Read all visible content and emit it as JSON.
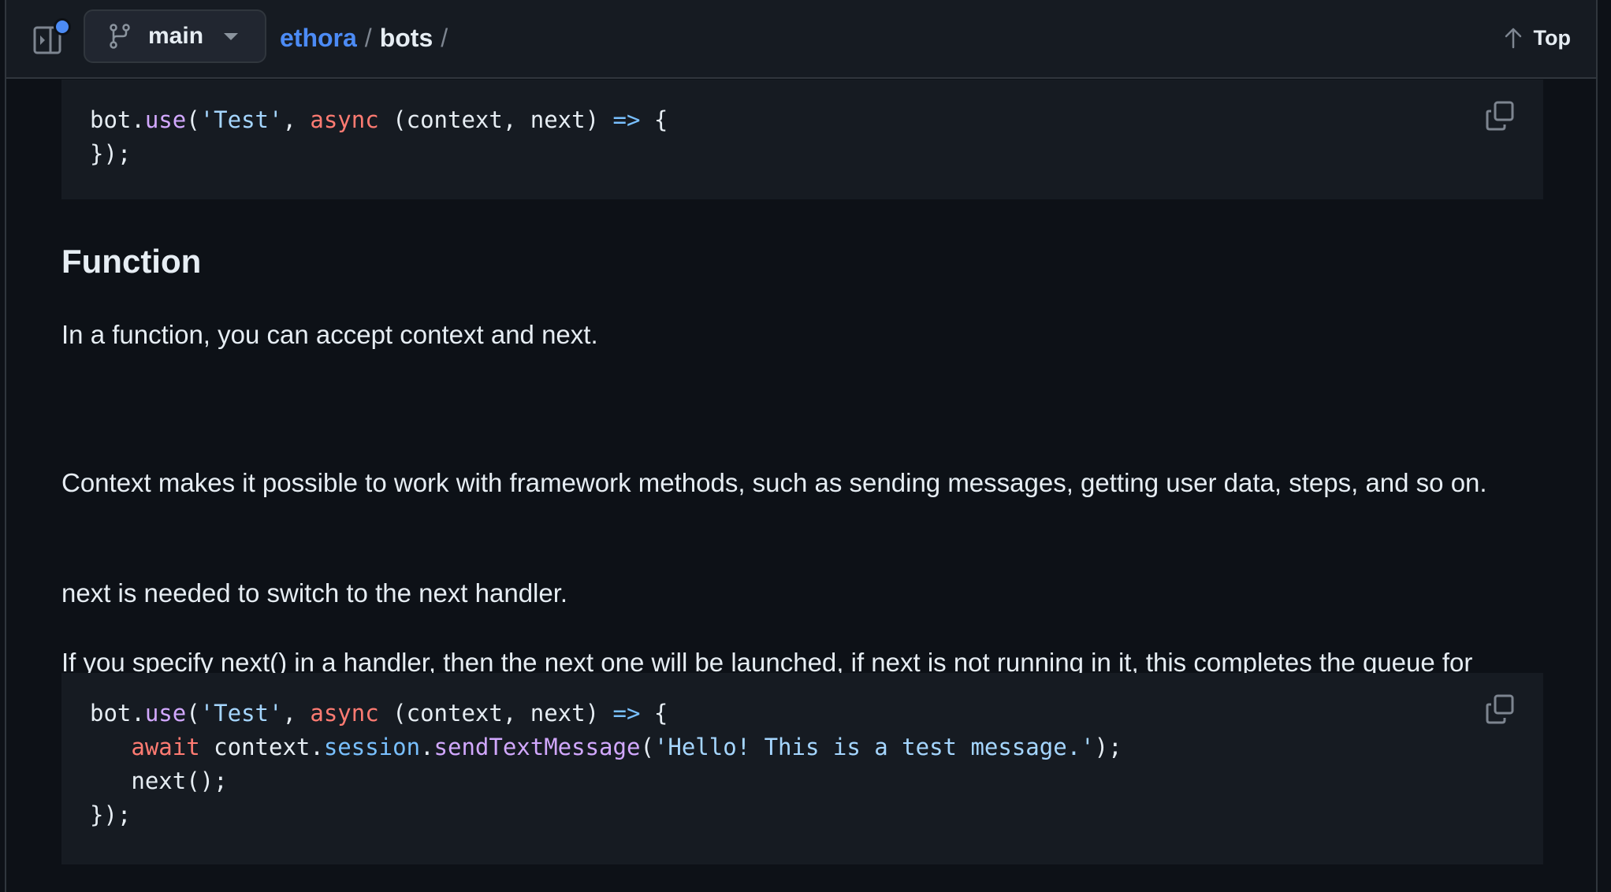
{
  "header": {
    "sidebar_toggle_icon": "sidebar-expand-icon",
    "branch": {
      "icon": "git-branch-icon",
      "name": "main",
      "dropdown_icon": "caret-down-icon"
    },
    "breadcrumb": {
      "repo": "ethora",
      "separator": "/",
      "folder": "bots",
      "trailing_separator": "/"
    },
    "top_button": {
      "icon": "arrow-up-icon",
      "label": "Top"
    }
  },
  "colors": {
    "accent": "#4c8bf5",
    "background": "#0d1117",
    "code_background": "#161b22",
    "text": "#e6edf3",
    "syntax_function": "#d2a8ff",
    "syntax_string": "#a5d6ff",
    "syntax_keyword": "#ff7b72",
    "syntax_operator": "#79c0ff"
  },
  "content": {
    "code_block_1": {
      "copy_icon": "copy-icon",
      "lines": [
        [
          {
            "t": "bot.",
            "c": ""
          },
          {
            "t": "use",
            "c": "fn"
          },
          {
            "t": "(",
            "c": ""
          },
          {
            "t": "'Test'",
            "c": "str"
          },
          {
            "t": ", ",
            "c": ""
          },
          {
            "t": "async",
            "c": "kw"
          },
          {
            "t": " (context, next) ",
            "c": ""
          },
          {
            "t": "=>",
            "c": "op"
          },
          {
            "t": " {",
            "c": ""
          }
        ],
        [
          {
            "t": "});",
            "c": ""
          }
        ]
      ]
    },
    "heading": "Function",
    "paragraphs": [
      "In a function, you can accept context and next.",
      "Context makes it possible to work with framework methods, such as sending messages, getting user data, steps, and so on.",
      "next is needed to switch to the next handler.",
      "If you specify next() in a handler, then the next one will be launched, if next is not running in it, this completes the queue for launching handlers."
    ],
    "code_block_2": {
      "copy_icon": "copy-icon",
      "lines": [
        [
          {
            "t": "bot.",
            "c": ""
          },
          {
            "t": "use",
            "c": "fn"
          },
          {
            "t": "(",
            "c": ""
          },
          {
            "t": "'Test'",
            "c": "str"
          },
          {
            "t": ", ",
            "c": ""
          },
          {
            "t": "async",
            "c": "kw"
          },
          {
            "t": " (context, next) ",
            "c": ""
          },
          {
            "t": "=>",
            "c": "op"
          },
          {
            "t": " {",
            "c": ""
          }
        ],
        [
          {
            "t": "   ",
            "c": ""
          },
          {
            "t": "await",
            "c": "kw"
          },
          {
            "t": " context.",
            "c": ""
          },
          {
            "t": "session",
            "c": "prop"
          },
          {
            "t": ".",
            "c": ""
          },
          {
            "t": "sendTextMessage",
            "c": "fn"
          },
          {
            "t": "(",
            "c": ""
          },
          {
            "t": "'Hello! This is a test message.'",
            "c": "str"
          },
          {
            "t": ");",
            "c": ""
          }
        ],
        [
          {
            "t": "   next();",
            "c": ""
          }
        ],
        [
          {
            "t": "});",
            "c": ""
          }
        ]
      ]
    }
  }
}
